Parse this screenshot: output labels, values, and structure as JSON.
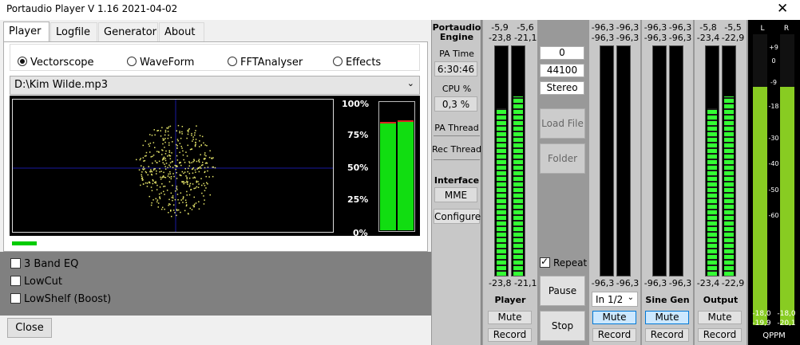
{
  "window": {
    "title": "Portaudio Player   V 1.16  2021-04-02",
    "close_glyph": "✕"
  },
  "tabs": [
    {
      "label": "Player",
      "active": true
    },
    {
      "label": "Logfile"
    },
    {
      "label": "Generator"
    },
    {
      "label": "About"
    }
  ],
  "player": {
    "modes": [
      {
        "label": "Vectorscope",
        "selected": true
      },
      {
        "label": "WaveForm"
      },
      {
        "label": "FFTAnalyser"
      },
      {
        "label": "Effects"
      }
    ],
    "file": "D:\\Kim Wilde.mp3",
    "percent_labels": [
      "100%",
      "75%",
      "50%",
      "25%",
      "0%"
    ],
    "level_left": 0.85,
    "level_right": 0.86,
    "progress": 0.06
  },
  "effects": [
    {
      "label": "3 Band EQ",
      "checked": false
    },
    {
      "label": "LowCut",
      "checked": false
    },
    {
      "label": "LowShelf (Boost)",
      "checked": false
    }
  ],
  "close_label": "Close",
  "engine": {
    "title": "Portaudio Engine",
    "pa_time_label": "PA Time",
    "pa_time": "6:30:46",
    "cpu_label": "CPU %",
    "cpu": "0,3 %",
    "pa_thread": "PA Thread",
    "rec_thread": "Rec Thread",
    "interface_label": "Interface",
    "interface": "MME",
    "configure": "Configure"
  },
  "player_strip": {
    "top": [
      "-5,9",
      "-5,6",
      "-23,8",
      "-21,1"
    ],
    "bottom": [
      "-23,8",
      "-21,1"
    ],
    "label": "Player",
    "mute": "Mute",
    "record": "Record",
    "level_l": 0.73,
    "level_r": 0.78
  },
  "controls": {
    "field1": "0",
    "samplerate": "44100",
    "channels": "Stereo",
    "load_file": "Load File",
    "folder": "Folder",
    "repeat_label": "Repeat",
    "repeat_checked": true,
    "pause": "Pause",
    "stop": "Stop"
  },
  "input_strip": {
    "top": [
      "-96,3",
      "-96,3",
      "-96,3",
      "-96,3"
    ],
    "bottom": [
      "-96,3",
      "-96,3"
    ],
    "select": "In 1/2",
    "mute": "Mute",
    "record": "Record"
  },
  "sine_strip": {
    "top": [
      "-96,3",
      "-96,3",
      "-96,3",
      "-96,3"
    ],
    "bottom": [
      "-96,3",
      "-96,3"
    ],
    "label": "Sine Gen",
    "mute": "Mute",
    "record": "Record"
  },
  "output_strip": {
    "top": [
      "-5,8",
      "-5,5",
      "-23,4",
      "-22,9"
    ],
    "bottom": [
      "-23,4",
      "-22,9"
    ],
    "label": "Output",
    "mute": "Mute",
    "record": "Record",
    "level_l": 0.73,
    "level_r": 0.78
  },
  "qppm": {
    "l": "L",
    "r": "R",
    "ticks": [
      "+9",
      "0",
      "-9",
      "-18",
      "-30",
      "-40",
      "-50",
      "-60"
    ],
    "bottom": [
      "-18,0",
      "-18,0",
      "-19,9",
      "-20,1"
    ],
    "label": "QPPM",
    "level_l": 0.82,
    "level_r": 0.82
  }
}
